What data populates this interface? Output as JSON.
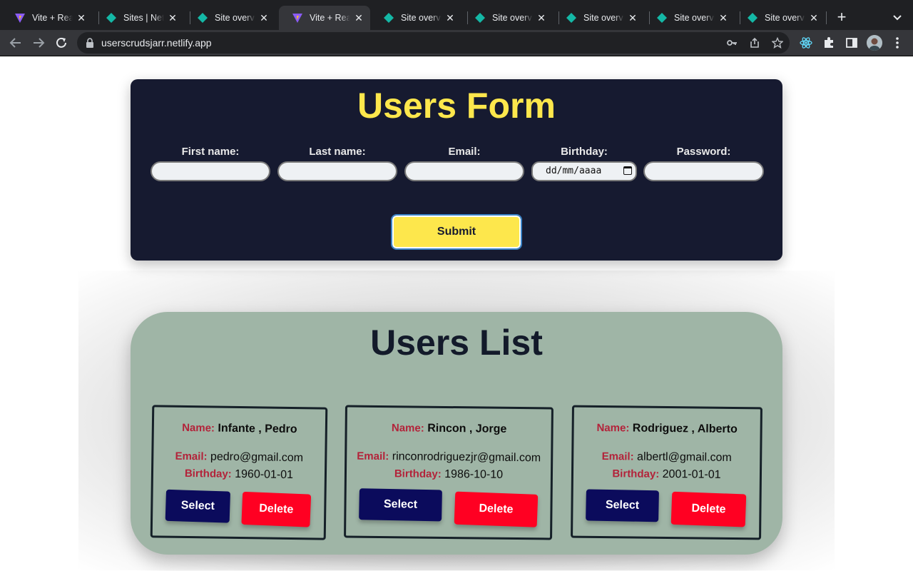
{
  "browser": {
    "tabs": [
      {
        "title": "Vite + React",
        "icon": "vite-icon",
        "active": false
      },
      {
        "title": "Sites | Netlify",
        "icon": "netlify-icon",
        "active": false
      },
      {
        "title": "Site overview",
        "icon": "netlify-icon",
        "active": false
      },
      {
        "title": "Vite + React",
        "icon": "vite-icon",
        "active": true
      },
      {
        "title": "Site overview",
        "icon": "netlify-icon",
        "active": false
      },
      {
        "title": "Site overview",
        "icon": "netlify-icon",
        "active": false
      },
      {
        "title": "Site overview",
        "icon": "netlify-icon",
        "active": false
      },
      {
        "title": "Site overview",
        "icon": "netlify-icon",
        "active": false
      },
      {
        "title": "Site overview",
        "icon": "netlify-icon",
        "active": false
      }
    ],
    "new_tab_label": "+",
    "url": "userscrudsjarr.netlify.app"
  },
  "form": {
    "title": "Users Form",
    "fields": [
      {
        "label": "First name:",
        "value": ""
      },
      {
        "label": "Last name:",
        "value": ""
      },
      {
        "label": "Email:",
        "value": ""
      },
      {
        "label": "Birthday:",
        "value": "dd/mm/aaaa"
      },
      {
        "label": "Password:",
        "value": ""
      }
    ],
    "submit_label": "Submit"
  },
  "list": {
    "title": "Users List",
    "name_label": "Name:",
    "email_label": "Email:",
    "birthday_label": "Birthday:",
    "select_label": "Select",
    "delete_label": "Delete",
    "users": [
      {
        "name": "Infante , Pedro",
        "email": "pedro@gmail.com",
        "birthday": "1960-01-01"
      },
      {
        "name": "Rincon , Jorge",
        "email": "rinconrodriguezjr@gmail.com",
        "birthday": "1986-10-10"
      },
      {
        "name": "Rodriguez , Alberto",
        "email": "albertl@gmail.com",
        "birthday": "2001-01-01"
      }
    ]
  },
  "colors": {
    "form_bg": "#161a30",
    "accent_yellow": "#fde74c",
    "list_bg": "#9fb5a6",
    "label_red": "#b3233a",
    "select_btn": "#0b0b5c",
    "delete_btn": "#ff0022"
  }
}
